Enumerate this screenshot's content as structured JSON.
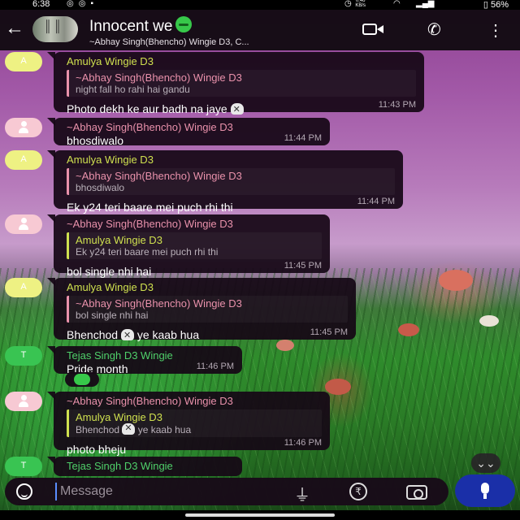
{
  "status_bar": {
    "time": "6:38",
    "network_speed": "0.46\nKB/s",
    "battery": "56%"
  },
  "header": {
    "title": "Innocent we",
    "subtitle": "~Abhay Singh(Bhencho) Wingie D3, C...",
    "icons": [
      "back-arrow-icon",
      "video-call-icon",
      "voice-call-icon",
      "more-options-icon"
    ]
  },
  "messages": [
    {
      "sender": "Amulya Wingie D3",
      "quote": {
        "sender": "~Abhay Singh(Bhencho) Wingie D3",
        "text": "night fall ho rahi hai gandu"
      },
      "text": "Photo dekh ke aur badh na jaye",
      "time": "11:43 PM"
    },
    {
      "sender": "~Abhay Singh(Bhencho) Wingie D3",
      "text": "bhosdiwalo",
      "time": "11:44 PM"
    },
    {
      "sender": "Amulya Wingie D3",
      "quote": {
        "sender": "~Abhay Singh(Bhencho) Wingie D3",
        "text": "bhosdiwalo"
      },
      "text": "Ek y24 teri baare mei puch rhi thi",
      "time": "11:44 PM"
    },
    {
      "sender": "~Abhay Singh(Bhencho) Wingie D3",
      "quote": {
        "sender": "Amulya Wingie D3",
        "text": "Ek y24 teri baare mei puch rhi thi"
      },
      "text": "bol single nhi hai",
      "time": "11:45 PM"
    },
    {
      "sender": "Amulya Wingie D3",
      "quote": {
        "sender": "~Abhay Singh(Bhencho) Wingie D3",
        "text": "bol single nhi hai"
      },
      "text_before": "Bhenchod",
      "text_after": "ye kaab hua",
      "time": "11:45 PM"
    },
    {
      "sender": "Tejas Singh D3 Wingie",
      "text": "Pride month",
      "time": "11:46 PM"
    },
    {
      "sender": "~Abhay Singh(Bhencho) Wingie D3",
      "quote": {
        "sender": "Amulya Wingie D3",
        "text_before": "Bhenchod",
        "text_after": "ye kaab hua"
      },
      "text": "photo bheju",
      "time": "11:46 PM"
    },
    {
      "sender": "Tejas Singh D3 Wingie"
    }
  ],
  "avatars": {
    "amulya": "A",
    "tejas": "T"
  },
  "input": {
    "placeholder": "Message"
  },
  "colors": {
    "amulya_name": "#cfe04f",
    "abhay_name": "#e991ab",
    "tejas_name": "#4fd06a",
    "mic_button": "#1a2fa8"
  }
}
